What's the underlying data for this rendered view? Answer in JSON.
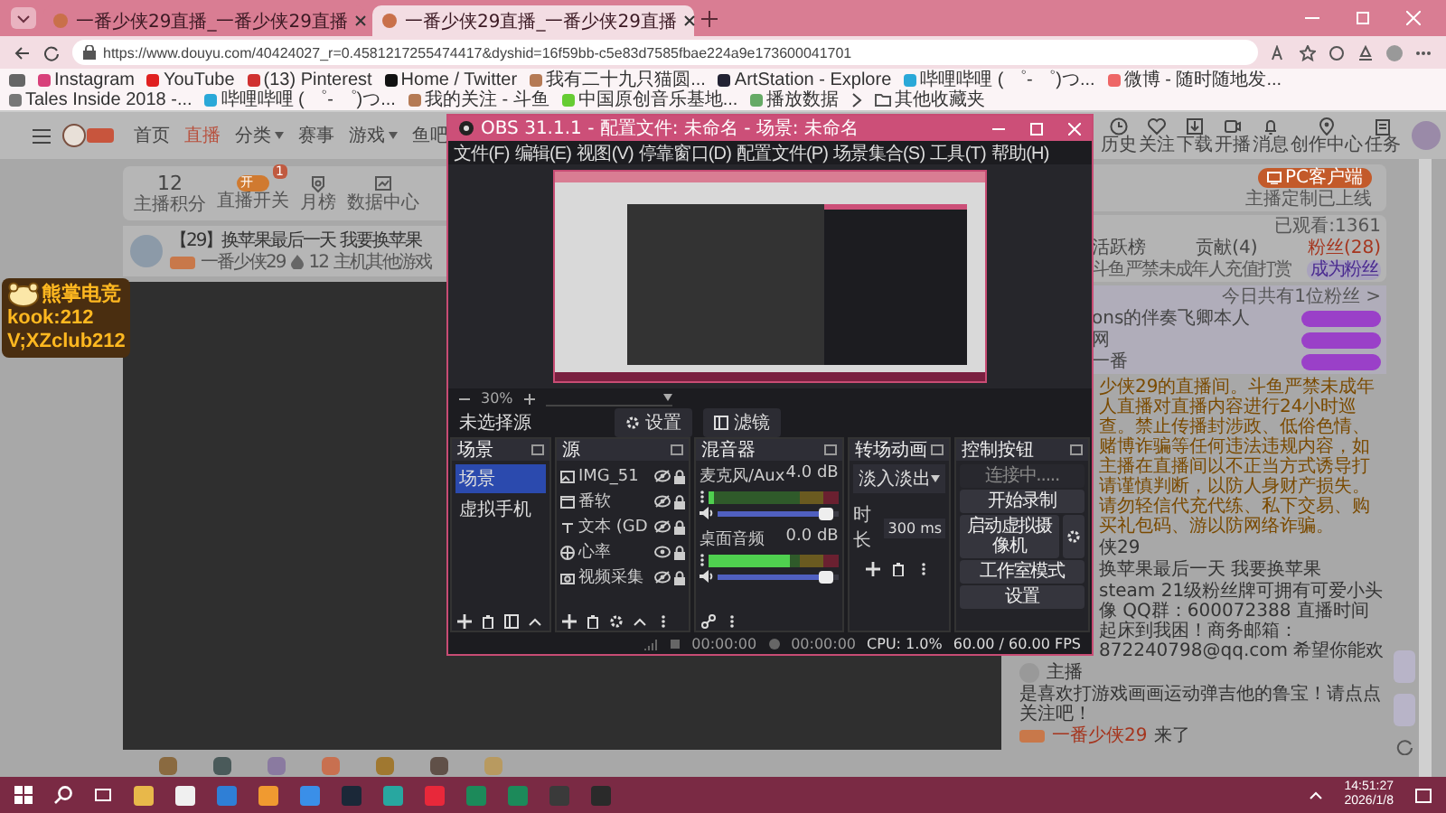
{
  "browser": {
    "tabs": [
      {
        "title": "一番少侠29直播_一番少侠29直播",
        "selected": false
      },
      {
        "title": "一番少侠29直播_一番少侠29直播",
        "selected": true
      }
    ],
    "url": "https://www.douyu.com/40424027_r=0.4581217255474417&dyshid=16f59bb-c5e83d7585fbae224a9e173600041701",
    "bookmarks": [
      "Instagram",
      "YouTube",
      "(13) Pinterest",
      "Home / Twitter",
      "我有二十九只猫圆...",
      "ArtStation - Explore",
      "哔哩哔哩 ( ゜- ゜)つ...",
      "微博 - 随时随地发...",
      "Tales Inside 2018 -...",
      "哔哩哔哩 ( ゜- ゜)つ...",
      "我的关注 - 斗鱼",
      "中国原创音乐基地...",
      "播放数据"
    ],
    "other_bookmarks": "其他收藏夹"
  },
  "site": {
    "nav": [
      {
        "label": "首页",
        "selected": false,
        "dropdown": false
      },
      {
        "label": "直播",
        "selected": true,
        "dropdown": false
      },
      {
        "label": "分类",
        "selected": false,
        "dropdown": true
      },
      {
        "label": "赛事",
        "selected": false,
        "dropdown": false
      },
      {
        "label": "游戏",
        "selected": false,
        "dropdown": true
      },
      {
        "label": "鱼吧",
        "selected": false,
        "dropdown": false
      }
    ],
    "header_links": [
      {
        "label": "历史",
        "kind": "clock"
      },
      {
        "label": "关注",
        "kind": "heart"
      },
      {
        "label": "下载",
        "kind": "download"
      },
      {
        "label": "开播",
        "kind": "camera"
      },
      {
        "label": "消息",
        "kind": "bell"
      },
      {
        "label": "创作中心",
        "kind": "pin"
      },
      {
        "label": "任务",
        "kind": "task"
      }
    ],
    "stats": {
      "score": "12",
      "score_label": "主播积分",
      "live_switch": {
        "label": "直播开关",
        "on": true,
        "text": "开",
        "badge": "1"
      },
      "links": [
        {
          "label": "月榜",
          "kind": "medal"
        },
        {
          "label": "数据中心",
          "kind": "chart"
        }
      ]
    },
    "room": {
      "title": "【29】换苹果最后一天 我要换苹果",
      "streamer": "一番少侠29",
      "likes": "12",
      "category": "主机其他游戏"
    },
    "ad": {
      "brand": "熊掌电竞",
      "line1": "kook:212",
      "line2": "V;XZclub212"
    },
    "client": {
      "button": "PC客户端",
      "note": "主播定制已上线"
    },
    "rank": {
      "views": "已观看:1361",
      "tabs": [
        {
          "label": "活跃榜",
          "selected": false
        },
        {
          "label": "贡献(4)",
          "selected": false
        },
        {
          "label": "粉丝(28)",
          "selected": true
        }
      ],
      "notice": "斗鱼严禁未成年人充值打赏",
      "join": "成为粉丝"
    },
    "fans": {
      "summary": "今日共有1位粉丝 >",
      "rows": [
        "ons的伴奏飞卿本人",
        "网",
        "一番"
      ]
    },
    "chat": [
      {
        "kind": "system",
        "text": "少侠29的直播间。斗鱼严禁未成年人直播对直播内容进行24小时巡查。禁止传播封涉政、低俗色情、赌博诈骗等任何违法违规内容，如主播在直播间以不正当方式诱导打请谨慎判断，以防人身财产损失。请勿轻信代充代练、私下交易、购买礼包码、游以防网络诈骗。"
      },
      {
        "kind": "line",
        "text": "侠29"
      },
      {
        "kind": "line",
        "text": "换苹果最后一天 我要换苹果"
      },
      {
        "kind": "line",
        "text": "steam 21级粉丝牌可拥有可爱小头像 QQ群：600072388 直播时间起床到我困！商务邮箱：872240798@qq.com 希望你能欢"
      },
      {
        "kind": "user",
        "text": "主播"
      },
      {
        "kind": "line",
        "text": "是喜欢打游戏画画运动弹吉他的鲁宝！请点点关注吧！"
      },
      {
        "kind": "enter",
        "user": "一番少侠29",
        "text": "来了"
      }
    ]
  },
  "obs": {
    "title": "OBS 31.1.1 - 配置文件: 未命名 - 场景: 未命名",
    "menu": [
      "文件(F)",
      "编辑(E)",
      "视图(V)",
      "停靠窗口(D)",
      "配置文件(P)",
      "场景集合(S)",
      "工具(T)",
      "帮助(H)"
    ],
    "zoom": "30%",
    "source_bar": {
      "label": "未选择源",
      "buttons": [
        "设置",
        "滤镜"
      ]
    },
    "docks": {
      "scenes": "场景",
      "sources": "源",
      "mixer": "混音器",
      "transitions": "转场动画",
      "controls": "控制按钮"
    },
    "scenes": [
      {
        "name": "场景",
        "selected": true
      },
      {
        "name": "虚拟手机",
        "selected": false
      }
    ],
    "sources": [
      {
        "name": "IMG_51",
        "kind": "image",
        "visible": false
      },
      {
        "name": "番软",
        "kind": "window",
        "visible": false
      },
      {
        "name": "文本 (GD",
        "kind": "text",
        "visible": false
      },
      {
        "name": "心率",
        "kind": "browser",
        "visible": true
      },
      {
        "name": "视频采集",
        "kind": "camera",
        "visible": false
      }
    ],
    "mixer": [
      {
        "name": "麦克风/Aux",
        "reading": "4.0 dB",
        "meter": {
          "level": 0.04
        },
        "volume": {
          "level": 0.95
        }
      },
      {
        "name": "桌面音频",
        "reading": "0.0 dB",
        "meter": {
          "level": 0.62
        },
        "volume": {
          "level": 0.95
        }
      }
    ],
    "transition": {
      "name": "淡入淡出",
      "duration_label": "时长",
      "duration": "300 ms"
    },
    "controls": [
      {
        "label": "连接中.....",
        "disabled": true,
        "gear": false
      },
      {
        "label": "开始录制",
        "disabled": false,
        "gear": false
      },
      {
        "label": "启动虚拟摄像机",
        "disabled": false,
        "gear": true
      },
      {
        "label": "工作室模式",
        "disabled": false,
        "gear": false
      },
      {
        "label": "设置",
        "disabled": false,
        "gear": false
      }
    ],
    "status": {
      "stream_time": "00:00:00",
      "record_time": "00:00:00",
      "cpu": "CPU: 1.0%",
      "fps": "60.00 / 60.00 FPS"
    }
  },
  "taskbar": {
    "time": "14:51:27",
    "date": "2026/1/8"
  }
}
